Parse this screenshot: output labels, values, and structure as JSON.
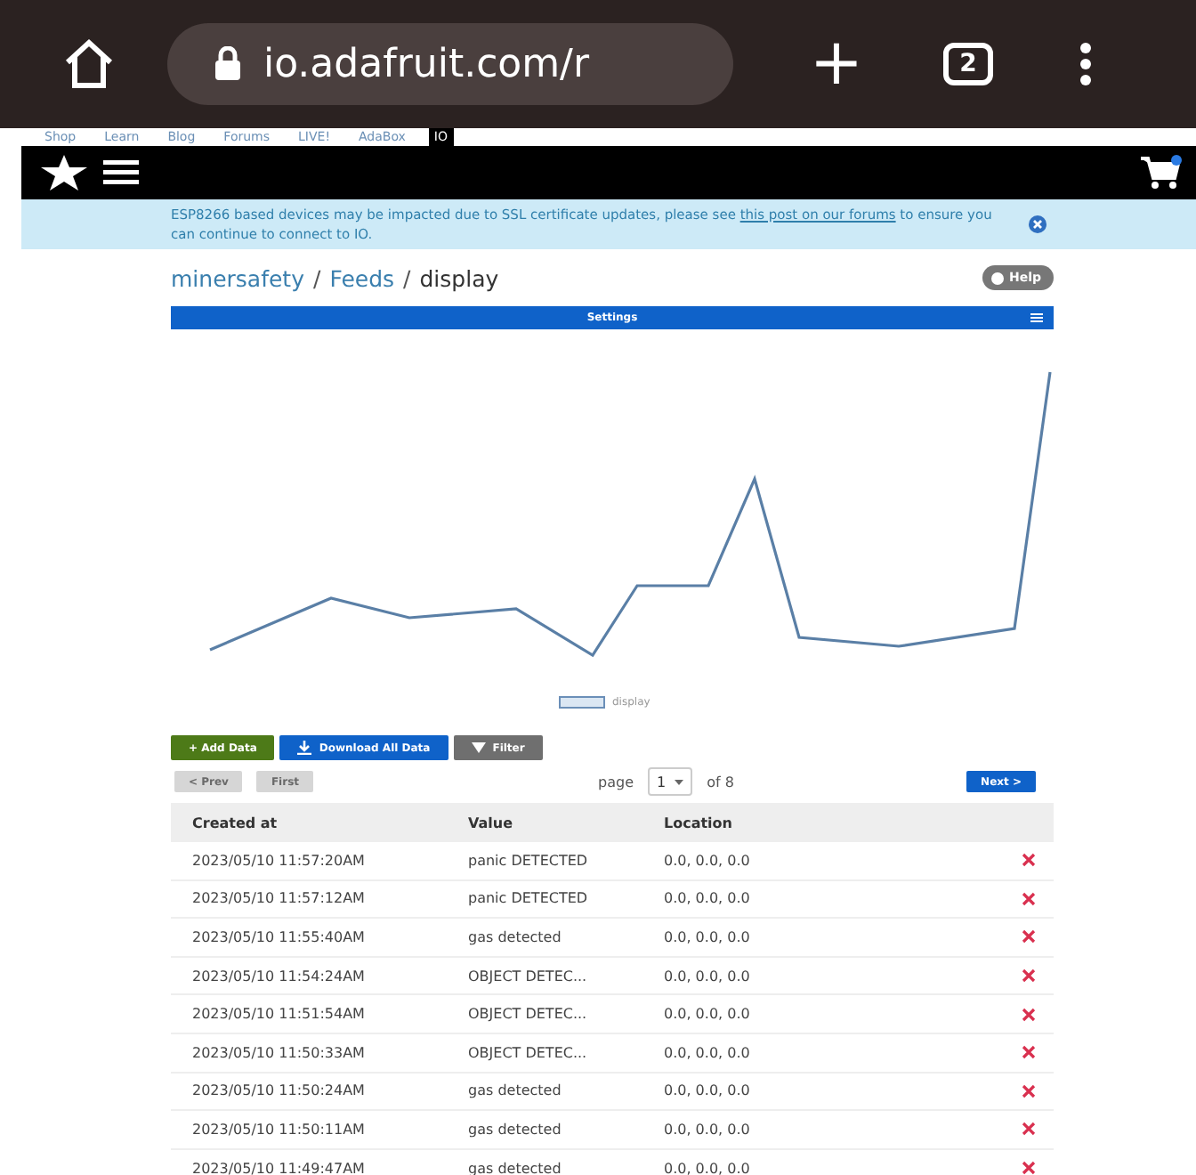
{
  "browser": {
    "url": "io.adafruit.com/r",
    "plus": "+",
    "tab_count": "2"
  },
  "top_nav": [
    {
      "label": "Shop",
      "selected": false
    },
    {
      "label": "Learn",
      "selected": false
    },
    {
      "label": "Blog",
      "selected": false
    },
    {
      "label": "Forums",
      "selected": false
    },
    {
      "label": "LIVE!",
      "selected": false
    },
    {
      "label": "AdaBox",
      "selected": false
    },
    {
      "label": "IO",
      "selected": true
    }
  ],
  "banner": {
    "text": "ESP8266 based devices may be impacted due to SSL certificate updates, please see",
    "link": "this post on our forums",
    "text_after": "to ensure you can continue to connect to IO."
  },
  "breadcrumb": {
    "separator": "/",
    "items": [
      {
        "label": "minersafety",
        "kind": "link"
      },
      {
        "label": "Feeds",
        "kind": "link"
      },
      {
        "label": "display",
        "kind": "current"
      }
    ]
  },
  "help_button": "Help",
  "settings_bar": "Settings",
  "chart": {
    "legend": "display"
  },
  "actions": [
    {
      "label": "+ Add Data",
      "kind": "add"
    },
    {
      "label": "Download All Data",
      "kind": "download"
    },
    {
      "label": "Filter",
      "kind": "filter"
    }
  ],
  "pagination": {
    "prev": "< Prev",
    "first": "First",
    "prev_disabled": true,
    "page_label": "page",
    "page": "1",
    "of": "of 8",
    "next": "Next >"
  },
  "table": {
    "columns": [
      "Created at",
      "Value",
      "Location"
    ],
    "rows": [
      {
        "created_at": "2023/05/10 11:57:20AM",
        "value": "panic DETECTED",
        "location": "0.0, 0.0, 0.0"
      },
      {
        "created_at": "2023/05/10 11:57:12AM",
        "value": "panic DETECTED",
        "location": "0.0, 0.0, 0.0"
      },
      {
        "created_at": "2023/05/10 11:55:40AM",
        "value": "gas detected",
        "location": "0.0, 0.0, 0.0"
      },
      {
        "created_at": "2023/05/10 11:54:24AM",
        "value": "OBJECT DETEC...",
        "location": "0.0, 0.0, 0.0"
      },
      {
        "created_at": "2023/05/10 11:51:54AM",
        "value": "OBJECT DETEC...",
        "location": "0.0, 0.0, 0.0"
      },
      {
        "created_at": "2023/05/10 11:50:33AM",
        "value": "OBJECT DETEC...",
        "location": "0.0, 0.0, 0.0"
      },
      {
        "created_at": "2023/05/10 11:50:24AM",
        "value": "gas detected",
        "location": "0.0, 0.0, 0.0"
      },
      {
        "created_at": "2023/05/10 11:50:11AM",
        "value": "gas detected",
        "location": "0.0, 0.0, 0.0"
      },
      {
        "created_at": "2023/05/10 11:49:47AM",
        "value": "gas detected",
        "location": "0.0, 0.0, 0.0"
      }
    ]
  }
}
